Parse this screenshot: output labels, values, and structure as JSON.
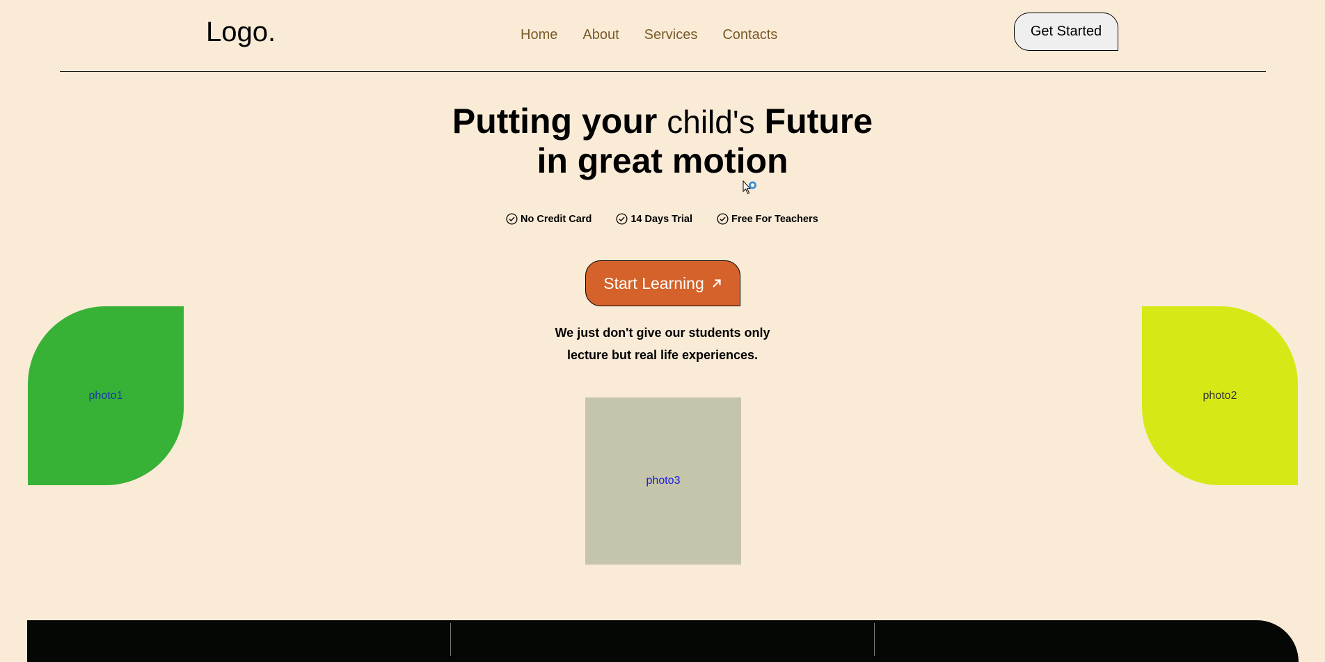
{
  "header": {
    "logo": "Logo.",
    "nav": [
      "Home",
      "About",
      "Services",
      "Contacts"
    ],
    "cta": "Get Started"
  },
  "hero": {
    "headline_part1": "Putting your",
    "headline_light": "child's",
    "headline_part2": "Future",
    "headline_line2": "in great motion",
    "features": [
      "No Credit Card",
      "14 Days Trial",
      "Free For Teachers"
    ],
    "start_button": "Start Learning",
    "tagline_line1": "We just don't give our students only",
    "tagline_line2": "lecture but real life experiences."
  },
  "photos": {
    "photo1": "photo1",
    "photo2": "photo2",
    "photo3": "photo3"
  },
  "colors": {
    "background": "#faebd7",
    "accent_orange": "#d4622a",
    "photo1_green": "#37b236",
    "photo2_lime": "#d6e916",
    "photo3_gray": "#c4c5aa",
    "band": "#050704"
  },
  "icons": {
    "feature_icon": "check-circle-icon",
    "button_icon": "arrow-up-right-icon"
  }
}
